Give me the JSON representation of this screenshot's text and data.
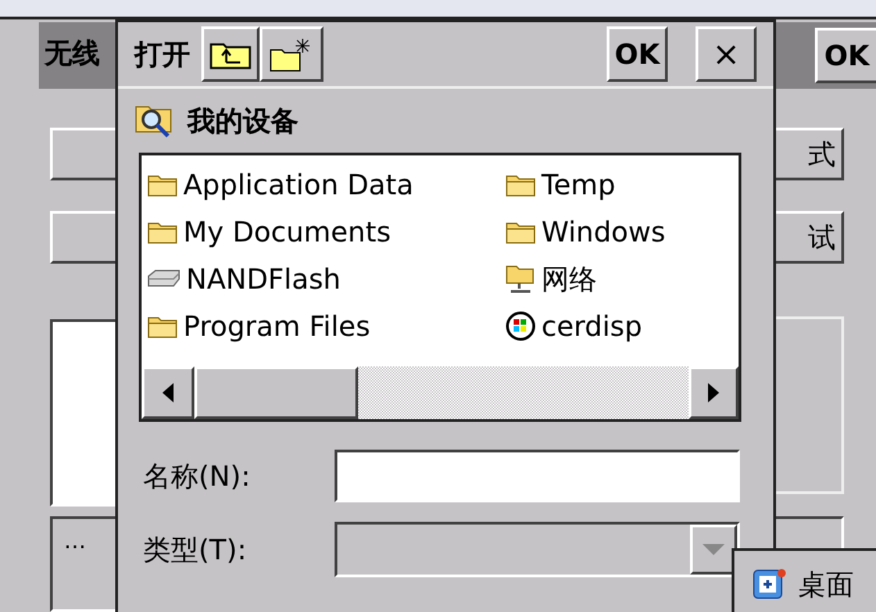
{
  "background_window": {
    "title": "无线",
    "ok_button": "OK",
    "right_buttons": [
      "式",
      "试"
    ],
    "status_box": "…"
  },
  "dialog": {
    "title": "打开",
    "ok_button": "OK",
    "close_button": "×",
    "location": "我的设备",
    "files": [
      {
        "name": "Application Data",
        "kind": "folder"
      },
      {
        "name": "Temp",
        "kind": "folder"
      },
      {
        "name": "My Documents",
        "kind": "folder"
      },
      {
        "name": "Windows",
        "kind": "folder"
      },
      {
        "name": "NANDFlash",
        "kind": "drive"
      },
      {
        "name": "网络",
        "kind": "network"
      },
      {
        "name": "Program Files",
        "kind": "folder"
      },
      {
        "name": "cerdisp",
        "kind": "app"
      }
    ],
    "name_label": "名称(N):",
    "type_label": "类型(T):",
    "type_disabled": true
  },
  "taskbar": {
    "desktop_button": "桌面"
  }
}
